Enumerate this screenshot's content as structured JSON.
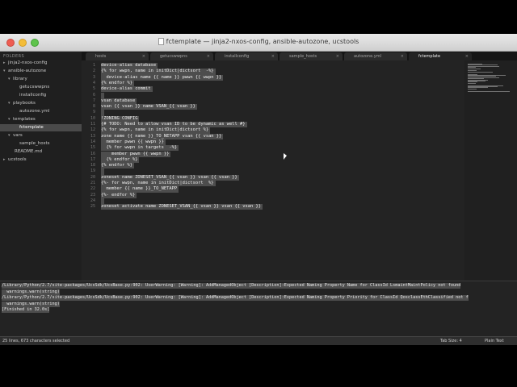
{
  "window": {
    "title": "fctemplate — jinja2-nxos-config, ansible-autozone, ucstools"
  },
  "sidebar": {
    "heading": "FOLDERS",
    "items": [
      {
        "label": "jinja2-nxos-config",
        "arrow": "▸"
      },
      {
        "label": "ansible-autozone",
        "arrow": "▾"
      },
      {
        "label": "library",
        "arrow": "▾"
      },
      {
        "label": "getucswwpns",
        "arrow": ""
      },
      {
        "label": "installconfig",
        "arrow": ""
      },
      {
        "label": "playbooks",
        "arrow": "▾"
      },
      {
        "label": "autozone.yml",
        "arrow": ""
      },
      {
        "label": "templates",
        "arrow": "▾"
      },
      {
        "label": "fctemplate",
        "arrow": ""
      },
      {
        "label": "vars",
        "arrow": "▾"
      },
      {
        "label": "sample_hosts",
        "arrow": ""
      },
      {
        "label": "README.md",
        "arrow": ""
      },
      {
        "label": "ucstools",
        "arrow": "▸"
      }
    ]
  },
  "tabs": [
    {
      "label": "hosts",
      "close": "×"
    },
    {
      "label": "getucswwpns",
      "close": "×"
    },
    {
      "label": "installconfig",
      "close": "×"
    },
    {
      "label": "sample_hosts",
      "close": "×"
    },
    {
      "label": "autozone.yml",
      "close": "×"
    },
    {
      "label": "fctemplate",
      "close": "×"
    }
  ],
  "editor": {
    "lines": [
      {
        "n": "1",
        "text": "device-alias database"
      },
      {
        "n": "2",
        "text": "{% for wwpn, name in initDict|dictsort  -%}"
      },
      {
        "n": "3",
        "text": "  device-alias name {{ name }} pwwn {{ wwpn }}"
      },
      {
        "n": "4",
        "text": "{% endfor %}"
      },
      {
        "n": "5",
        "text": "device-alias commit"
      },
      {
        "n": "6",
        "text": ""
      },
      {
        "n": "7",
        "text": "vsan database"
      },
      {
        "n": "8",
        "text": "vsan {{ vsan }} name VSAN_{{ vsan }}"
      },
      {
        "n": "9",
        "text": ""
      },
      {
        "n": "10",
        "text": "!ZONING CONFIG"
      },
      {
        "n": "11",
        "text": "{# TODO: Need to allow vsan ID to be dynamic as well #}"
      },
      {
        "n": "12",
        "text": "{% for wwpn, name in initDict|dictsort %}"
      },
      {
        "n": "13",
        "text": "zone name {{ name }}_TO_NETAPP vsan {{ vsan }}"
      },
      {
        "n": "14",
        "text": "  member pwwn {{ wwpn }}"
      },
      {
        "n": "15",
        "text": "  {% for wwpn in targets  -%}"
      },
      {
        "n": "16",
        "text": "    member pwwn {{ wwpn }}"
      },
      {
        "n": "17",
        "text": "  {% endfor %}"
      },
      {
        "n": "18",
        "text": "{% endfor %}"
      },
      {
        "n": "19",
        "text": ""
      },
      {
        "n": "20",
        "text": "zoneset name ZONESET_VSAN_{{ vsan }} vsan {{ vsan }}"
      },
      {
        "n": "21",
        "text": "{%- for wwpn, name in initDict|dictsort  %}"
      },
      {
        "n": "22",
        "text": "  member {{ name }}_TO_NETAPP"
      },
      {
        "n": "23",
        "text": "{%- endfor %}"
      },
      {
        "n": "24",
        "text": ""
      },
      {
        "n": "25",
        "text": "zoneset activate name ZONESET_VSAN_{{ vsan }} vsan {{ vsan }}"
      }
    ]
  },
  "console": {
    "lines": [
      "/Library/Python/2.7/site-packages/UcsSdk/UcsBase.py:902: UserWarning: [Warning]: AddManagedObject [Description]:Expected Naming Property Name for ClassId LsmaintMaintPolicy not found",
      "  warnings.warn(string)",
      "/Library/Python/2.7/site-packages/UcsSdk/UcsBase.py:902: UserWarning: [Warning]: AddManagedObject [Description]:Expected Naming Property Priority for ClassId QosclassEthClassified not f",
      "  warnings.warn(string)",
      "[Finished in 32.0s]"
    ]
  },
  "status": {
    "left": "25 lines, 673 characters selected",
    "tab_size": "Tab Size: 4",
    "syntax": "Plain Text"
  }
}
